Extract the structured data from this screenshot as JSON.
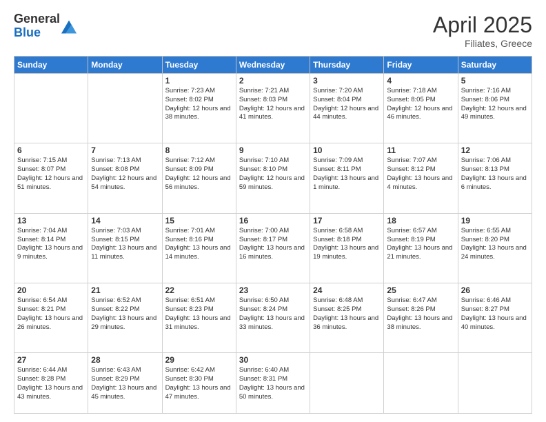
{
  "logo": {
    "general": "General",
    "blue": "Blue"
  },
  "title": "April 2025",
  "location": "Filiates, Greece",
  "weekdays": [
    "Sunday",
    "Monday",
    "Tuesday",
    "Wednesday",
    "Thursday",
    "Friday",
    "Saturday"
  ],
  "weeks": [
    [
      {
        "day": "",
        "info": ""
      },
      {
        "day": "",
        "info": ""
      },
      {
        "day": "1",
        "info": "Sunrise: 7:23 AM\nSunset: 8:02 PM\nDaylight: 12 hours and 38 minutes."
      },
      {
        "day": "2",
        "info": "Sunrise: 7:21 AM\nSunset: 8:03 PM\nDaylight: 12 hours and 41 minutes."
      },
      {
        "day": "3",
        "info": "Sunrise: 7:20 AM\nSunset: 8:04 PM\nDaylight: 12 hours and 44 minutes."
      },
      {
        "day": "4",
        "info": "Sunrise: 7:18 AM\nSunset: 8:05 PM\nDaylight: 12 hours and 46 minutes."
      },
      {
        "day": "5",
        "info": "Sunrise: 7:16 AM\nSunset: 8:06 PM\nDaylight: 12 hours and 49 minutes."
      }
    ],
    [
      {
        "day": "6",
        "info": "Sunrise: 7:15 AM\nSunset: 8:07 PM\nDaylight: 12 hours and 51 minutes."
      },
      {
        "day": "7",
        "info": "Sunrise: 7:13 AM\nSunset: 8:08 PM\nDaylight: 12 hours and 54 minutes."
      },
      {
        "day": "8",
        "info": "Sunrise: 7:12 AM\nSunset: 8:09 PM\nDaylight: 12 hours and 56 minutes."
      },
      {
        "day": "9",
        "info": "Sunrise: 7:10 AM\nSunset: 8:10 PM\nDaylight: 12 hours and 59 minutes."
      },
      {
        "day": "10",
        "info": "Sunrise: 7:09 AM\nSunset: 8:11 PM\nDaylight: 13 hours and 1 minute."
      },
      {
        "day": "11",
        "info": "Sunrise: 7:07 AM\nSunset: 8:12 PM\nDaylight: 13 hours and 4 minutes."
      },
      {
        "day": "12",
        "info": "Sunrise: 7:06 AM\nSunset: 8:13 PM\nDaylight: 13 hours and 6 minutes."
      }
    ],
    [
      {
        "day": "13",
        "info": "Sunrise: 7:04 AM\nSunset: 8:14 PM\nDaylight: 13 hours and 9 minutes."
      },
      {
        "day": "14",
        "info": "Sunrise: 7:03 AM\nSunset: 8:15 PM\nDaylight: 13 hours and 11 minutes."
      },
      {
        "day": "15",
        "info": "Sunrise: 7:01 AM\nSunset: 8:16 PM\nDaylight: 13 hours and 14 minutes."
      },
      {
        "day": "16",
        "info": "Sunrise: 7:00 AM\nSunset: 8:17 PM\nDaylight: 13 hours and 16 minutes."
      },
      {
        "day": "17",
        "info": "Sunrise: 6:58 AM\nSunset: 8:18 PM\nDaylight: 13 hours and 19 minutes."
      },
      {
        "day": "18",
        "info": "Sunrise: 6:57 AM\nSunset: 8:19 PM\nDaylight: 13 hours and 21 minutes."
      },
      {
        "day": "19",
        "info": "Sunrise: 6:55 AM\nSunset: 8:20 PM\nDaylight: 13 hours and 24 minutes."
      }
    ],
    [
      {
        "day": "20",
        "info": "Sunrise: 6:54 AM\nSunset: 8:21 PM\nDaylight: 13 hours and 26 minutes."
      },
      {
        "day": "21",
        "info": "Sunrise: 6:52 AM\nSunset: 8:22 PM\nDaylight: 13 hours and 29 minutes."
      },
      {
        "day": "22",
        "info": "Sunrise: 6:51 AM\nSunset: 8:23 PM\nDaylight: 13 hours and 31 minutes."
      },
      {
        "day": "23",
        "info": "Sunrise: 6:50 AM\nSunset: 8:24 PM\nDaylight: 13 hours and 33 minutes."
      },
      {
        "day": "24",
        "info": "Sunrise: 6:48 AM\nSunset: 8:25 PM\nDaylight: 13 hours and 36 minutes."
      },
      {
        "day": "25",
        "info": "Sunrise: 6:47 AM\nSunset: 8:26 PM\nDaylight: 13 hours and 38 minutes."
      },
      {
        "day": "26",
        "info": "Sunrise: 6:46 AM\nSunset: 8:27 PM\nDaylight: 13 hours and 40 minutes."
      }
    ],
    [
      {
        "day": "27",
        "info": "Sunrise: 6:44 AM\nSunset: 8:28 PM\nDaylight: 13 hours and 43 minutes."
      },
      {
        "day": "28",
        "info": "Sunrise: 6:43 AM\nSunset: 8:29 PM\nDaylight: 13 hours and 45 minutes."
      },
      {
        "day": "29",
        "info": "Sunrise: 6:42 AM\nSunset: 8:30 PM\nDaylight: 13 hours and 47 minutes."
      },
      {
        "day": "30",
        "info": "Sunrise: 6:40 AM\nSunset: 8:31 PM\nDaylight: 13 hours and 50 minutes."
      },
      {
        "day": "",
        "info": ""
      },
      {
        "day": "",
        "info": ""
      },
      {
        "day": "",
        "info": ""
      }
    ]
  ]
}
